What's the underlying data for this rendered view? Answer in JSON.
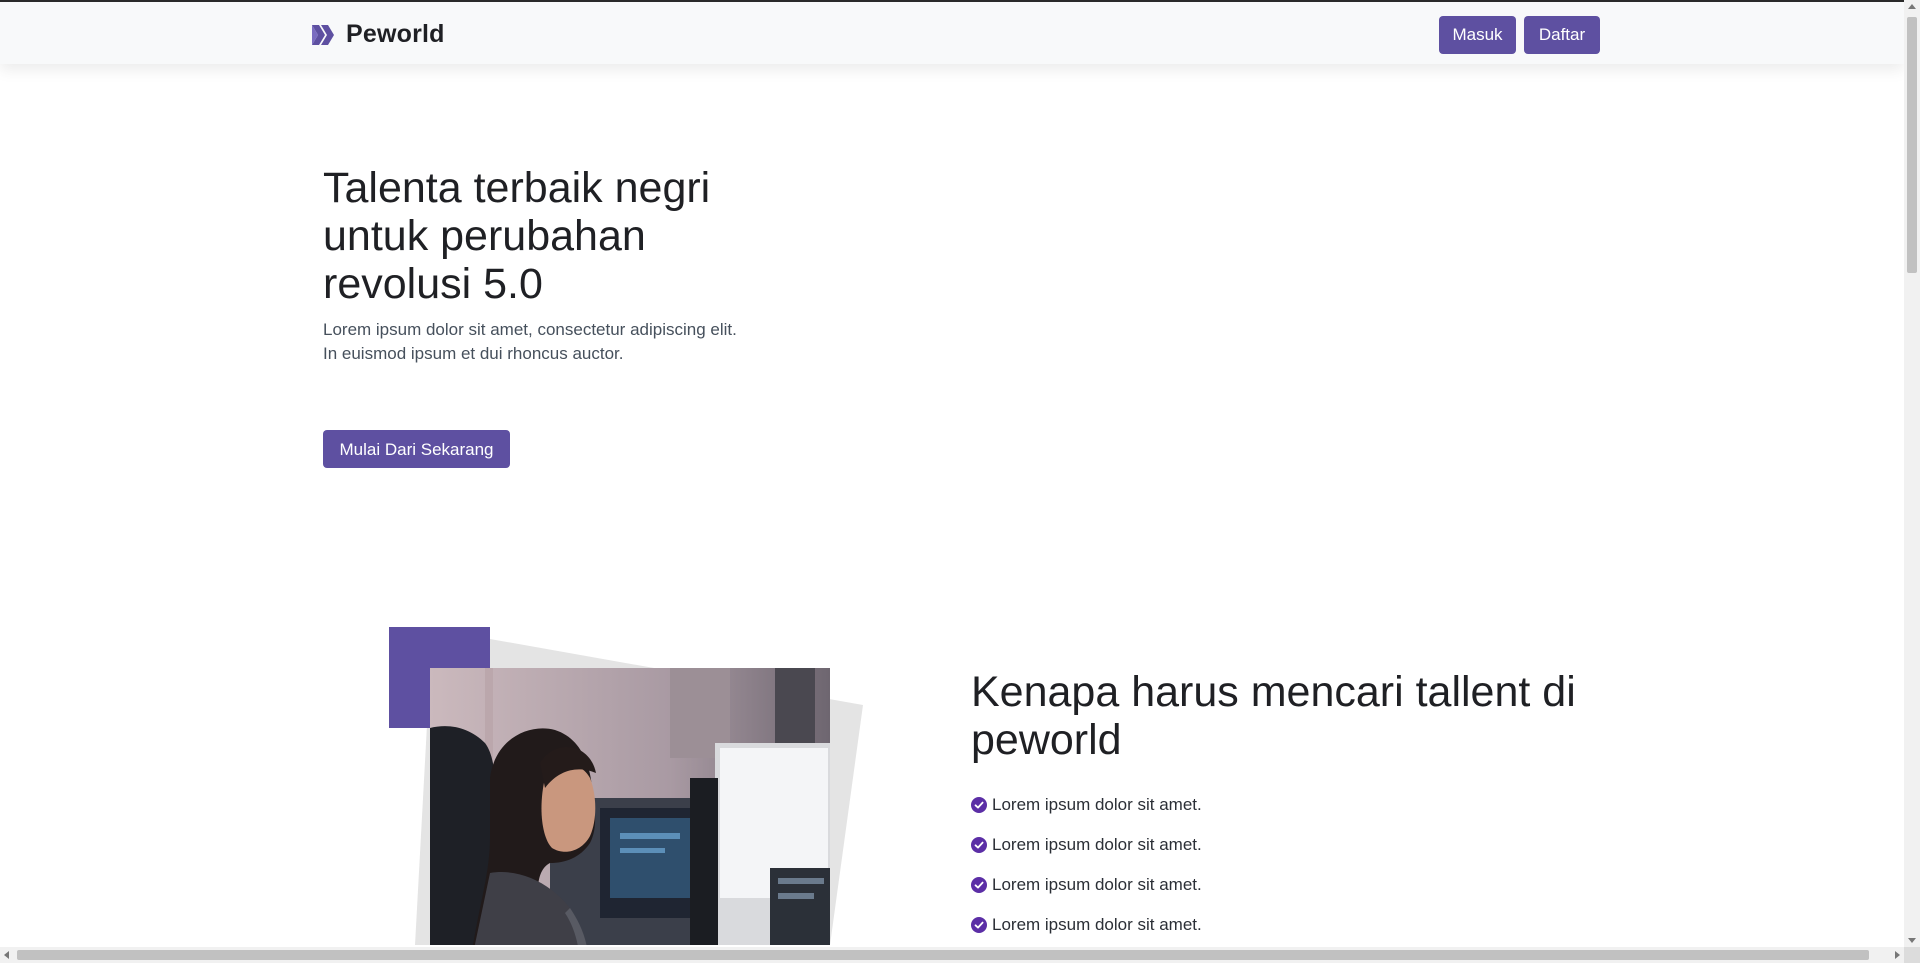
{
  "colors": {
    "primary": "#5e50a1",
    "navbar_bg": "#f8f9fa",
    "heading": "#1f2024",
    "body_text": "#46505c",
    "check_icon": "#5b2ea6"
  },
  "navbar": {
    "brand": {
      "icon": "peworld-logo-icon",
      "name": "Peworld"
    },
    "login_label": "Masuk",
    "register_label": "Daftar"
  },
  "hero": {
    "title": "Talenta terbaik negri untuk perubahan revolusi 5.0",
    "description": "Lorem ipsum dolor sit amet, consectetur adipiscing elit. In euismod ipsum et dui rhoncus auctor.",
    "cta_label": "Mulai Dari Sekarang"
  },
  "why_section": {
    "image": {
      "icon": "office-workers-photo"
    },
    "title": "Kenapa harus mencari tallent di peworld",
    "items": [
      {
        "icon": "check-circle-icon",
        "text": "Lorem ipsum dolor sit amet."
      },
      {
        "icon": "check-circle-icon",
        "text": "Lorem ipsum dolor sit amet."
      },
      {
        "icon": "check-circle-icon",
        "text": "Lorem ipsum dolor sit amet."
      },
      {
        "icon": "check-circle-icon",
        "text": "Lorem ipsum dolor sit amet."
      }
    ]
  }
}
